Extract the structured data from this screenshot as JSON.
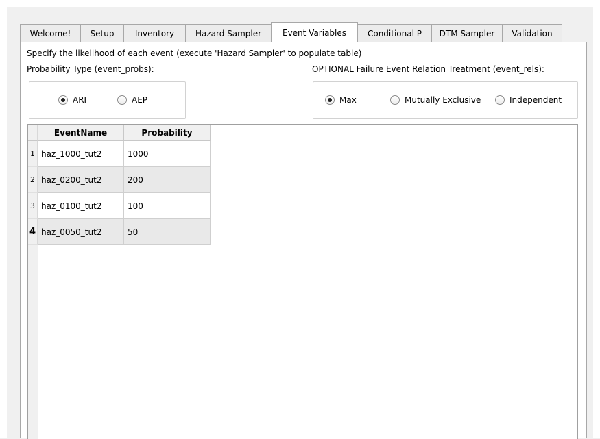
{
  "tabs": [
    {
      "label": "Welcome!",
      "active": false
    },
    {
      "label": "Setup",
      "active": false
    },
    {
      "label": "Inventory",
      "active": false
    },
    {
      "label": "Hazard Sampler",
      "active": false
    },
    {
      "label": "Event Variables",
      "active": true
    },
    {
      "label": "Conditional P",
      "active": false
    },
    {
      "label": "DTM Sampler",
      "active": false
    },
    {
      "label": "Validation",
      "active": false
    }
  ],
  "panel": {
    "instructions": "Specify the likelihood of each event  (execute 'Hazard Sampler' to populate table)",
    "prob_type_label": "Probability Type (event_probs):",
    "relation_label": "OPTIONAL Failure Event Relation Treatment (event_rels):"
  },
  "prob_type": {
    "options": [
      "ARI",
      "AEP"
    ],
    "selected": "ARI"
  },
  "relation": {
    "options": [
      "Max",
      "Mutually Exclusive",
      "Independent"
    ],
    "selected": "Max"
  },
  "table": {
    "columns": [
      "EventName",
      "Probability"
    ],
    "rows": [
      {
        "num": "1",
        "event": "haz_1000_tut2",
        "prob": "1000"
      },
      {
        "num": "2",
        "event": "haz_0200_tut2",
        "prob": "200"
      },
      {
        "num": "3",
        "event": "haz_0100_tut2",
        "prob": "100"
      },
      {
        "num": "4",
        "event": "haz_0050_tut2",
        "prob": "50"
      }
    ],
    "current_row": "4"
  },
  "colors": {
    "alt_row": "#e9e9e9",
    "tab_border": "#a8a8a8"
  }
}
